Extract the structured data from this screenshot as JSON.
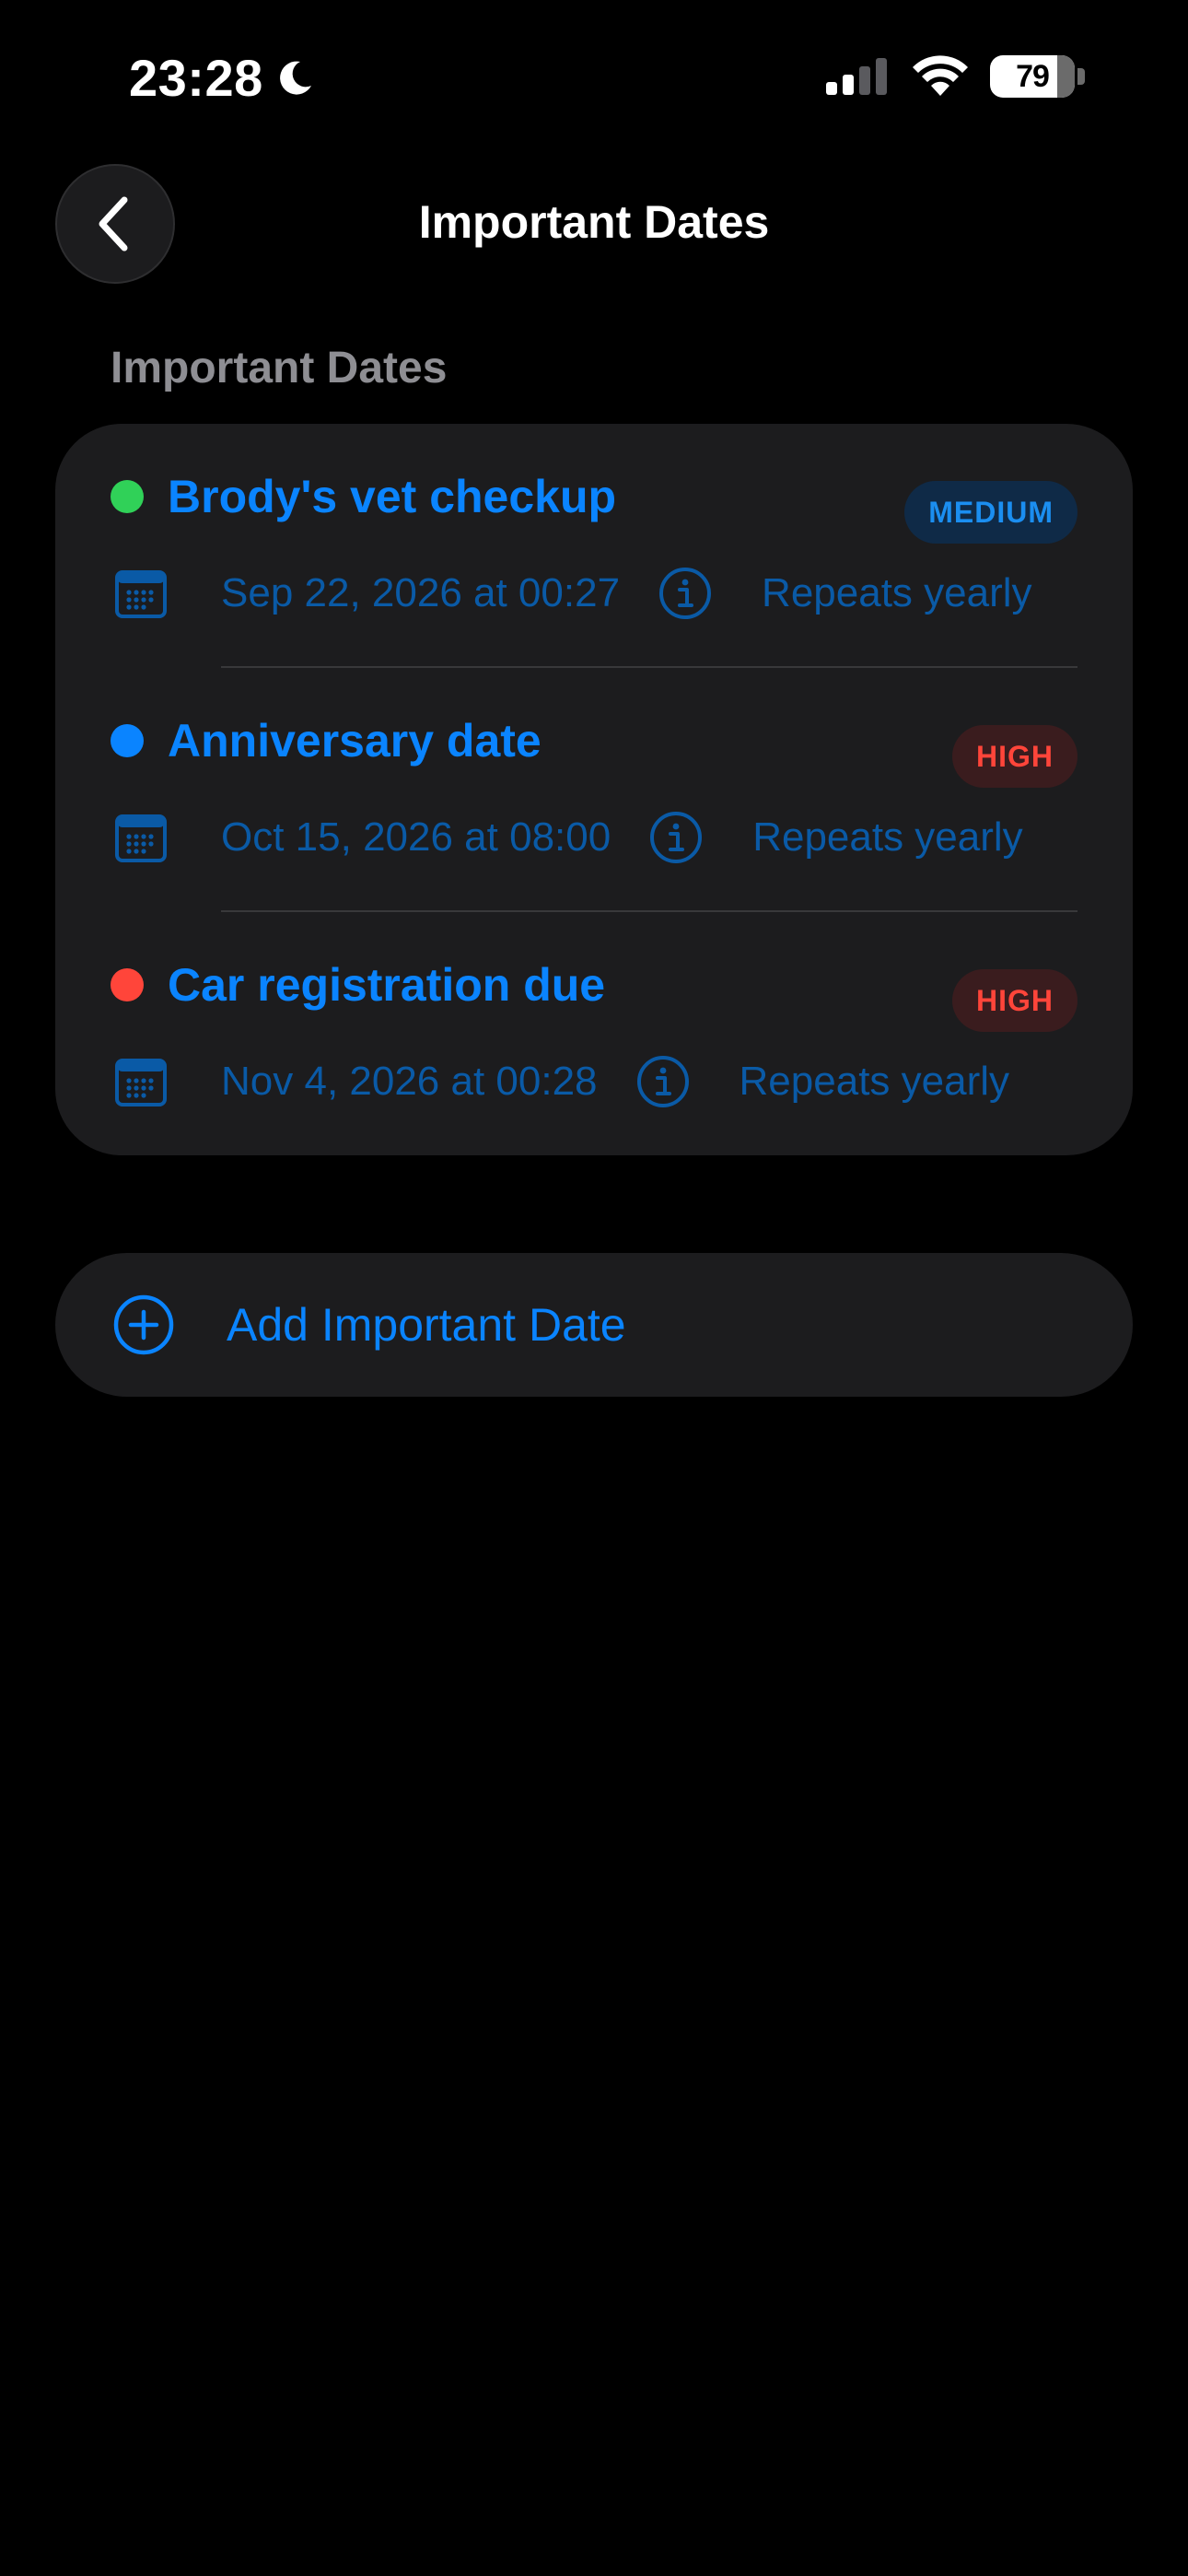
{
  "status_bar": {
    "time": "23:28",
    "battery_percent": "79",
    "battery_level": 0.79,
    "icons": [
      "moon-icon",
      "signal-icon",
      "wifi-icon",
      "battery-icon"
    ]
  },
  "nav": {
    "title": "Important Dates",
    "back_icon": "chevron-left-icon"
  },
  "section": {
    "header": "Important Dates"
  },
  "items": [
    {
      "title": "Brody's vet checkup",
      "dot_color": "#30d158",
      "priority": "MEDIUM",
      "date": "Sep 22, 2026 at 00:27",
      "repeat": "Repeats yearly"
    },
    {
      "title": "Anniversary date",
      "dot_color": "#0a84ff",
      "priority": "HIGH",
      "date": "Oct 15, 2026 at 08:00",
      "repeat": "Repeats yearly"
    },
    {
      "title": "Car registration due",
      "dot_color": "#ff453a",
      "priority": "HIGH",
      "date": "Nov 4, 2026 at 00:28",
      "repeat": "Repeats yearly"
    }
  ],
  "add_button": {
    "label": "Add Important Date",
    "icon": "plus-circle-icon"
  },
  "colors": {
    "accent": "#0a84ff",
    "detail_text": "#0a5aa6",
    "card_background": "#1c1c1e",
    "page_background": "#000000",
    "medium_badge_bg": "#0f2a47",
    "high_badge_bg": "#3a1c1e",
    "high_badge_text": "#ff453a"
  }
}
